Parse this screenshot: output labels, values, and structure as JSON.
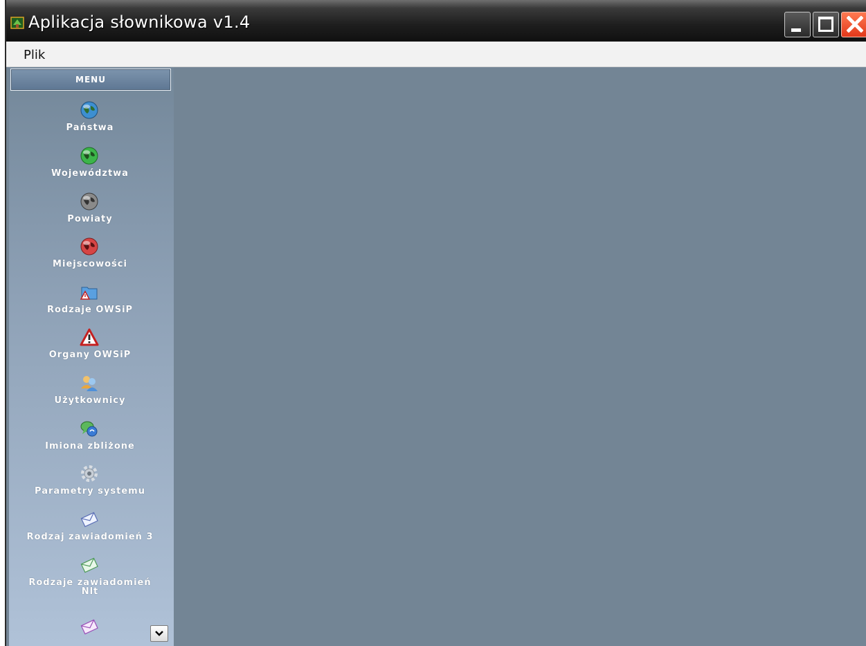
{
  "window": {
    "title": "Aplikacja słownikowa v1.4",
    "bg_color": "#738595",
    "controls": [
      "minimize-icon",
      "maximize-icon",
      "close-icon"
    ]
  },
  "menubar": {
    "items": [
      {
        "label": "Plik"
      }
    ]
  },
  "sidebar": {
    "header": "MENU",
    "items": [
      {
        "label": "Państwa",
        "icon": "globe-blue-icon"
      },
      {
        "label": "Województwa",
        "icon": "globe-green-icon"
      },
      {
        "label": "Powiaty",
        "icon": "globe-gray-icon"
      },
      {
        "label": "Miejscowości",
        "icon": "globe-red-icon"
      },
      {
        "label": "Rodzaje OWSiP",
        "icon": "folder-warning-icon"
      },
      {
        "label": "Organy OWSiP",
        "icon": "warning-icon"
      },
      {
        "label": "Użytkownicy",
        "icon": "users-icon"
      },
      {
        "label": "Imiona zbliżone",
        "icon": "chat-bubbles-icon"
      },
      {
        "label": "Parametry systemu",
        "icon": "gear-icon"
      },
      {
        "label": "Rodzaj zawiadomień 3",
        "icon": "envelope-blue-icon"
      },
      {
        "label": "Rodzaje zawiadomień Nlt",
        "icon": "envelope-green-icon"
      },
      {
        "label": "",
        "icon": "envelope-purple-icon"
      }
    ],
    "scroll_button": "chevron-down-icon"
  }
}
